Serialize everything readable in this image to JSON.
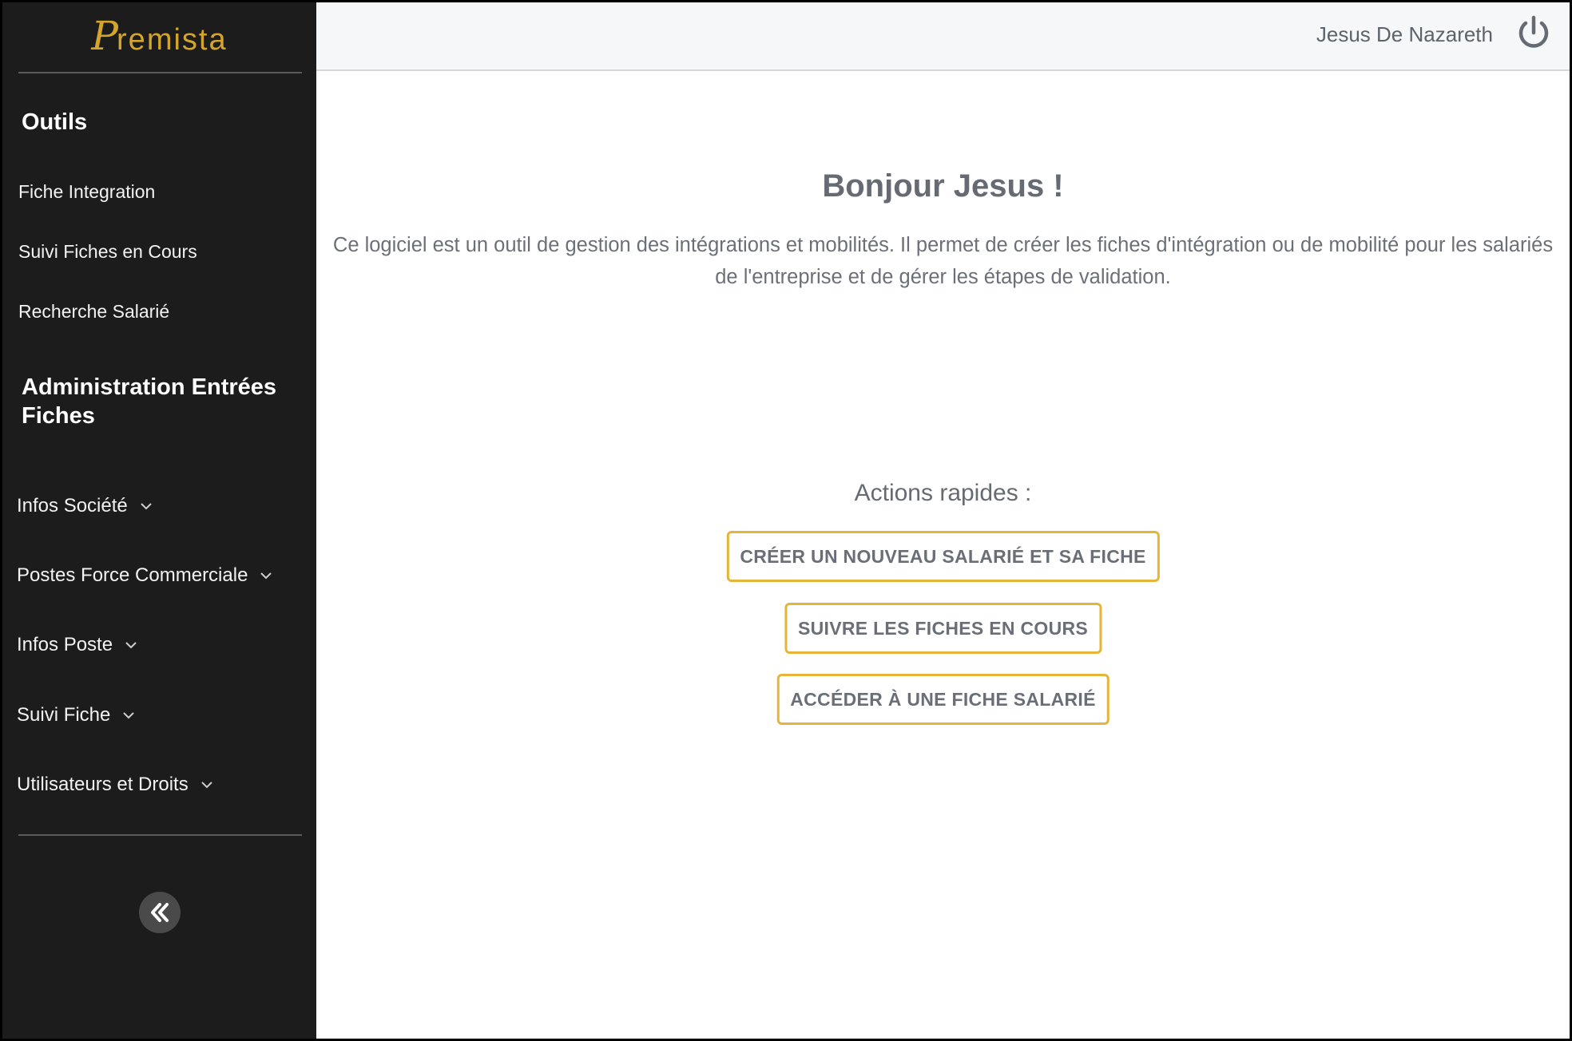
{
  "brand": {
    "logo_initial": "P",
    "logo_rest": "remista"
  },
  "sidebar": {
    "section_tools": "Outils",
    "tools": [
      {
        "label": "Fiche Integration"
      },
      {
        "label": "Suivi Fiches en Cours"
      },
      {
        "label": "Recherche Salarié"
      }
    ],
    "section_admin_line1": "Administration Entrées",
    "section_admin_line2": "Fiches",
    "admin_items": [
      {
        "label": "Infos Société"
      },
      {
        "label": "Postes Force Commerciale"
      },
      {
        "label": "Infos Poste"
      },
      {
        "label": "Suivi Fiche"
      },
      {
        "label": "Utilisateurs et Droits"
      }
    ],
    "collapse_icon": "chevrons-left-icon"
  },
  "header": {
    "user_name": "Jesus De Nazareth",
    "logout_icon": "power-icon"
  },
  "main": {
    "greeting": "Bonjour Jesus !",
    "description": "Ce logiciel est un outil de gestion des intégrations et mobilités. Il permet de créer les fiches d'intégration ou de mobilité pour les salariés de l'entreprise et de gérer les étapes de validation.",
    "actions_title": "Actions rapides :",
    "actions": [
      {
        "label": "CRÉER UN NOUVEAU SALARIÉ ET SA FICHE"
      },
      {
        "label": "SUIVRE LES FICHES EN COURS"
      },
      {
        "label": "ACCÉDER À UNE FICHE SALARIÉ"
      }
    ]
  },
  "colors": {
    "sidebar_bg": "#1c1c1c",
    "accent": "#e4b53a",
    "logo": "#d4a52c",
    "text_muted": "#6b7078"
  }
}
